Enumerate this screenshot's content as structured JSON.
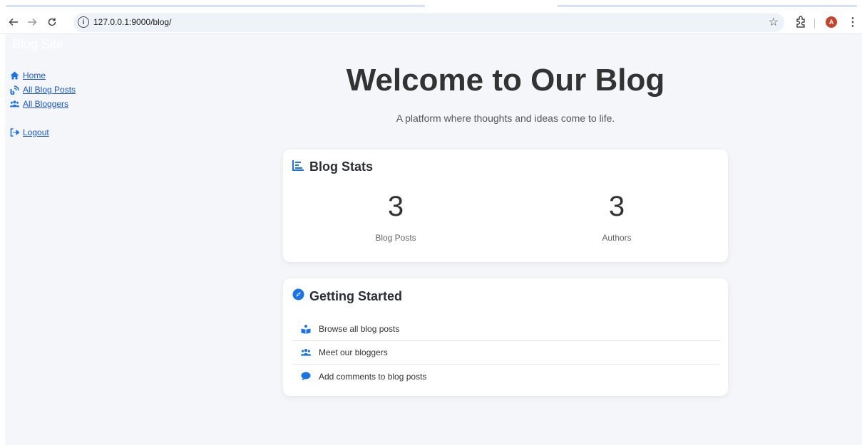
{
  "browser": {
    "url": "127.0.0.1:9000/blog/",
    "profile_initial": "A"
  },
  "site": {
    "brand": "Blog Site"
  },
  "sidebar": {
    "items": [
      {
        "label": "Home",
        "icon": "home-icon"
      },
      {
        "label": "All Blog Posts",
        "icon": "blog-icon"
      },
      {
        "label": "All Bloggers",
        "icon": "users-icon"
      },
      {
        "label": "Logout",
        "icon": "logout-icon"
      }
    ]
  },
  "hero": {
    "title": "Welcome to Our Blog",
    "subtitle": "A platform where thoughts and ideas come to life."
  },
  "stats": {
    "title": "Blog Stats",
    "posts_count": "3",
    "posts_label": "Blog Posts",
    "authors_count": "3",
    "authors_label": "Authors"
  },
  "getting_started": {
    "title": "Getting Started",
    "items": [
      {
        "label": "Browse all blog posts",
        "icon": "blog-reader-icon"
      },
      {
        "label": "Meet our bloggers",
        "icon": "users-icon"
      },
      {
        "label": "Add comments to blog posts",
        "icon": "comment-icon"
      }
    ]
  },
  "colors": {
    "accent": "#1a73e8",
    "link": "#1a56db",
    "page_bg": "#f4f6f9"
  }
}
